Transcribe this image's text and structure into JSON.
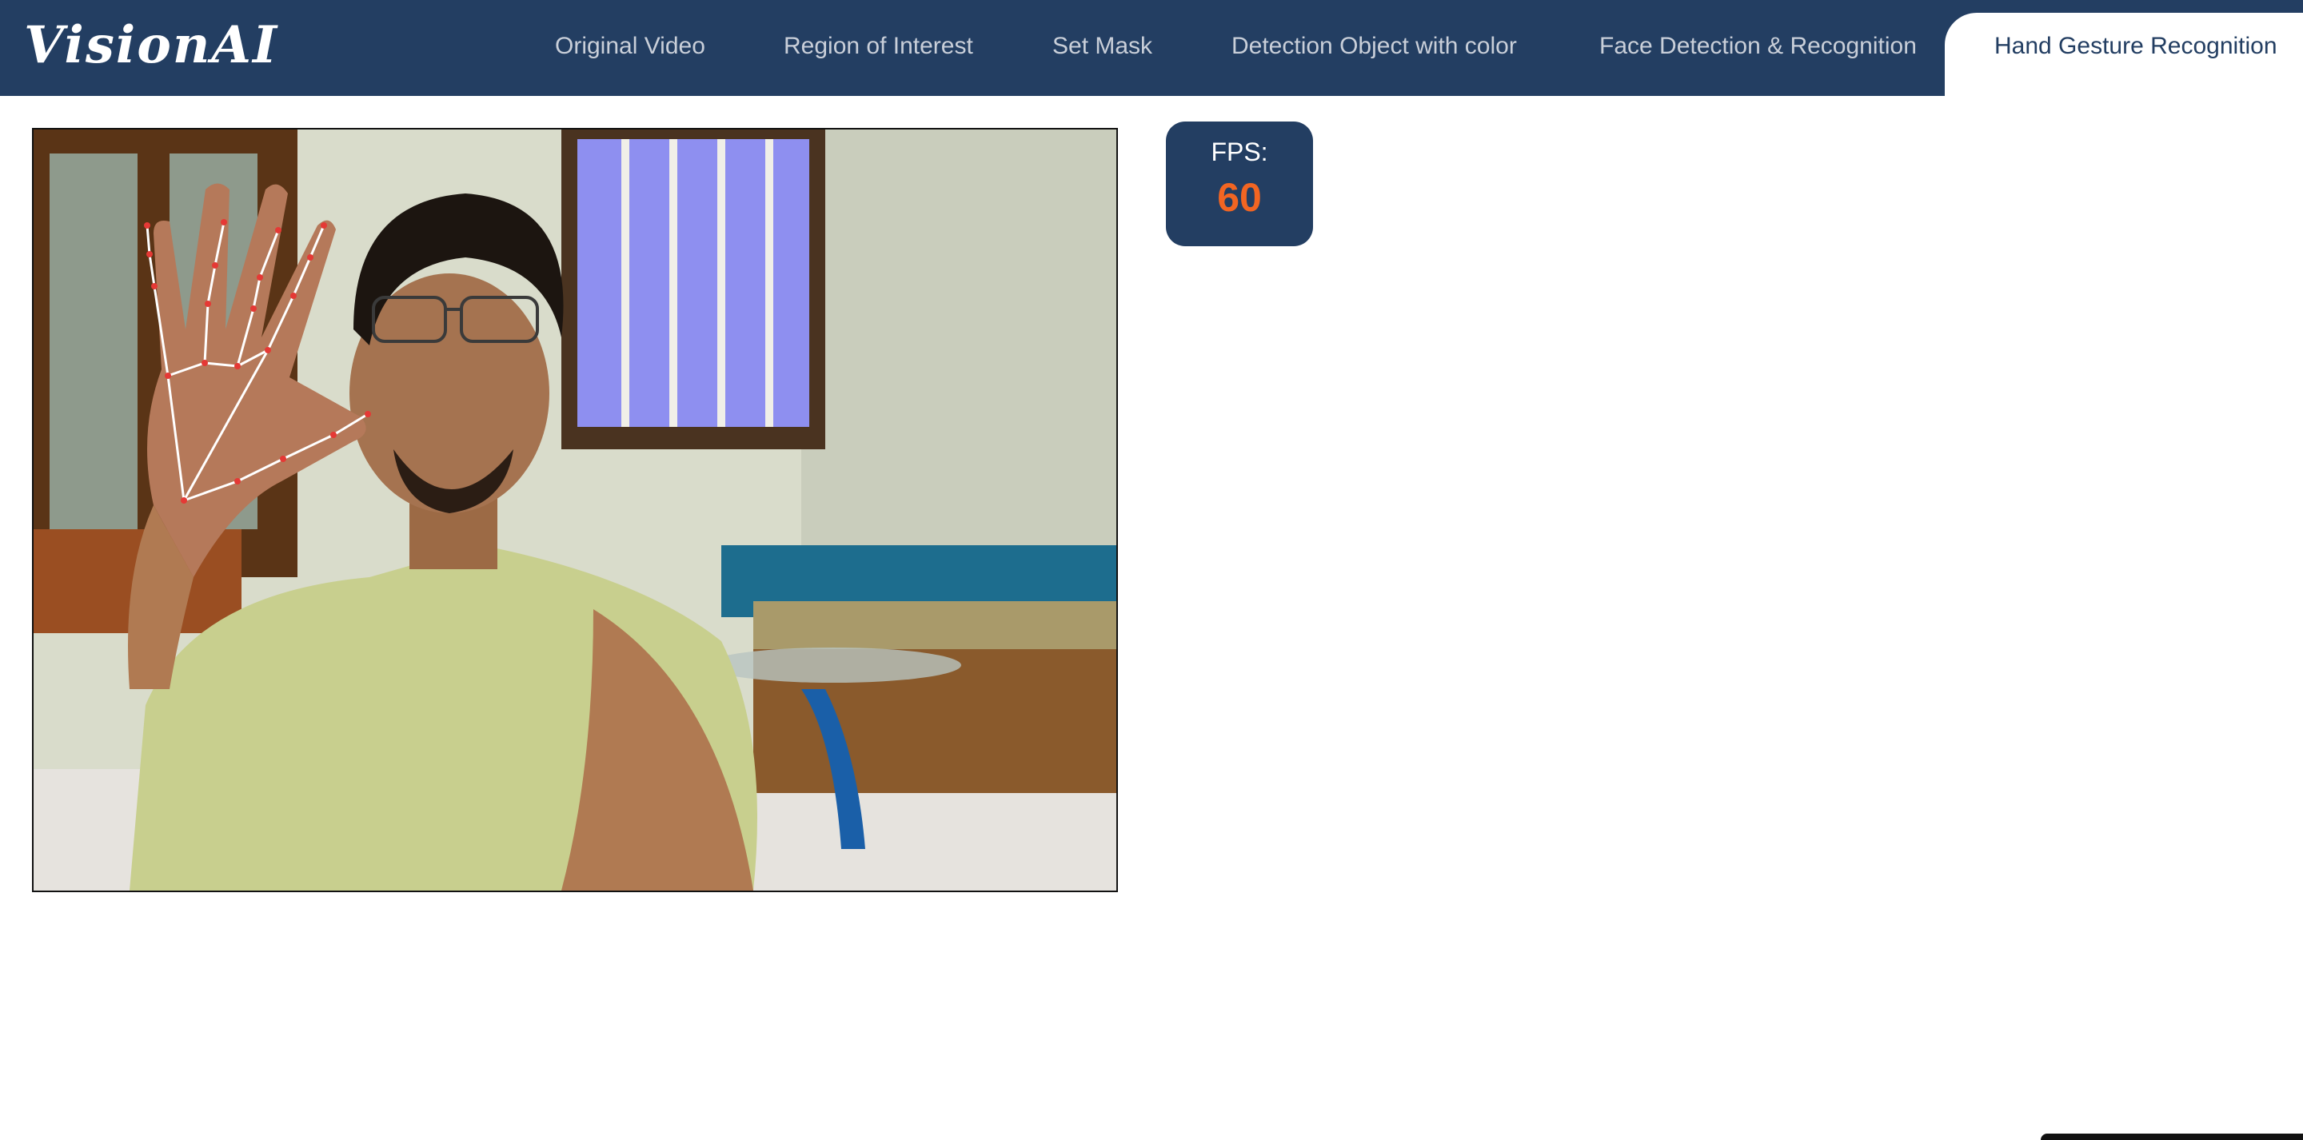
{
  "app": {
    "logo_text": "VisionAI"
  },
  "nav": {
    "tabs": [
      {
        "label": "Original Video",
        "active": false
      },
      {
        "label": "Region of Interest",
        "active": false
      },
      {
        "label": "Set Mask",
        "active": false
      },
      {
        "label": "Detection Object with color",
        "active": false
      },
      {
        "label": "Face Detection & Recognition",
        "active": false
      },
      {
        "label": "Hand Gesture Recognition",
        "active": true
      }
    ]
  },
  "fps": {
    "label": "FPS:",
    "value": "60"
  },
  "colors": {
    "nav_background": "#233e62",
    "tab_inactive_text": "#c9cfd9",
    "tab_active_text": "#233e62",
    "fps_value": "#f26522",
    "landmark_point": "#e53935",
    "landmark_line": "#ffffff"
  },
  "video": {
    "content": "webcam-feed-with-hand-landmarks"
  }
}
